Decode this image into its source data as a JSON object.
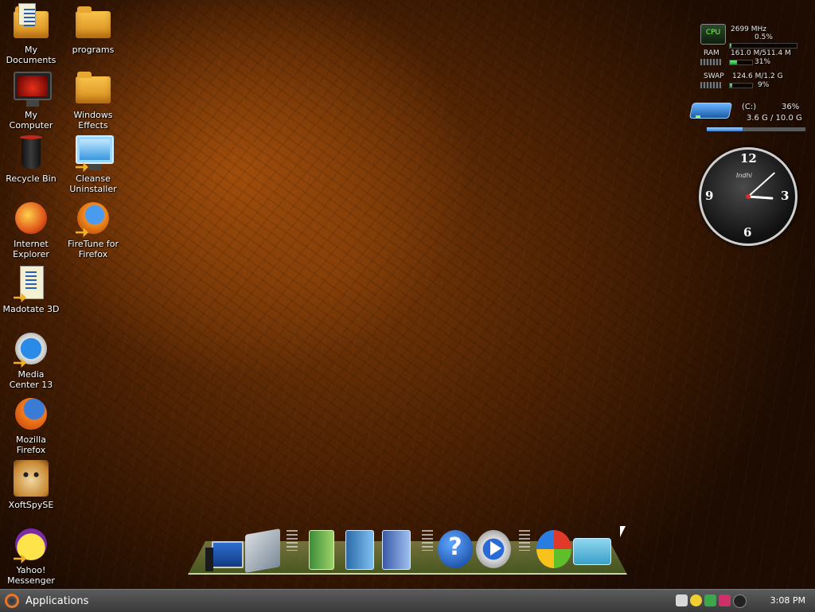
{
  "desktop": {
    "icons": [
      {
        "label": "My\nDocuments"
      },
      {
        "label": "programs"
      },
      {
        "label": "My\nComputer"
      },
      {
        "label": "Windows\nEffects"
      },
      {
        "label": "Recycle Bin"
      },
      {
        "label": "Cleanse\nUninstaller"
      },
      {
        "label": "Internet\nExplorer"
      },
      {
        "label": "FireTune for\nFirefox"
      },
      {
        "label": "Madotate 3D"
      },
      {
        "label": "Media\nCenter 13"
      },
      {
        "label": "Mozilla\nFirefox"
      },
      {
        "label": "XoftSpySE"
      },
      {
        "label": "Yahoo!\nMessenger"
      }
    ]
  },
  "sysmon": {
    "cpu_label": "CPU",
    "cpu_freq": "2699 MHz",
    "cpu_pct": "0.5%",
    "cpu_fraction": 0.005,
    "ram_label": "RAM",
    "ram_usage": "161.0 M/511.4 M",
    "ram_pct": "31%",
    "ram_fraction": 0.31,
    "swap_label": "SWAP",
    "swap_usage": "124.6 M/1.2 G",
    "swap_pct": "9%",
    "swap_fraction": 0.09,
    "drive_label": "(C:)",
    "drive_pct": "36%",
    "drive_usage": "3.6 G / 10.0 G",
    "drive_fraction": 0.36
  },
  "clock": {
    "n12": "12",
    "n3": "3",
    "n6": "6",
    "n9": "9",
    "brand": "Indhi",
    "hour": 3,
    "minute": 8
  },
  "dock": {
    "items": [
      "my-computer-icon",
      "network-icon",
      "documents-icon",
      "images-icon",
      "media-icon",
      "help-icon",
      "media-player-icon",
      "windows-update-icon",
      "recycle-icon"
    ]
  },
  "taskbar": {
    "applications_label": "Applications",
    "time": "3:08 PM"
  },
  "colors": {
    "accent_green": "#1d9b30",
    "drive_blue": "#3a7ed0",
    "ubuntu_orange": "#e8762b"
  }
}
